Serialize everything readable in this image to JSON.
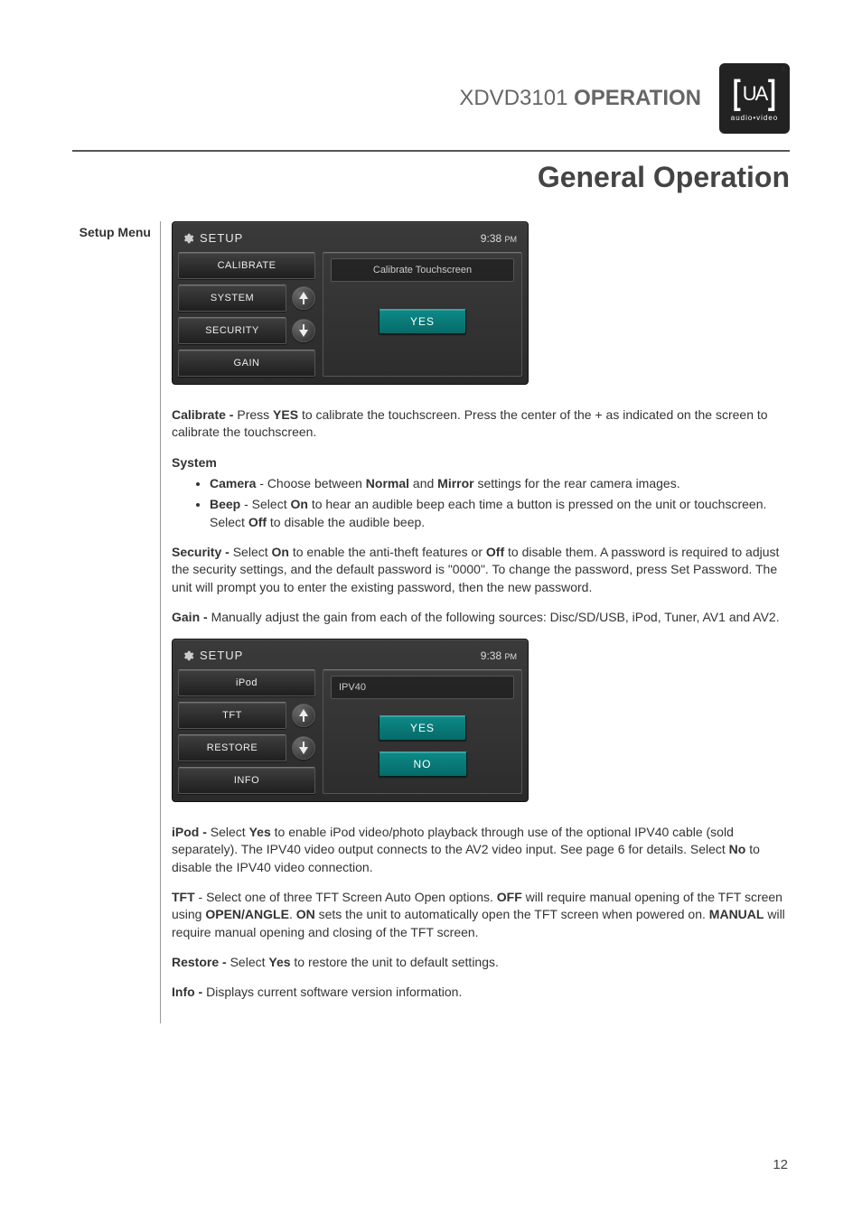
{
  "header": {
    "model": "XDVD3101",
    "section": "OPERATION",
    "logo_sub": "audio•video",
    "trademark": "®"
  },
  "page_heading": "General Operation",
  "left_label": "Setup Menu",
  "screen1": {
    "title": "SETUP",
    "time": "9:38",
    "time_suffix": "PM",
    "menu": {
      "item1": "CALIBRATE",
      "item2": "SYSTEM",
      "item3": "SECURITY",
      "item4": "GAIN"
    },
    "panel_title": "Calibrate Touchscreen",
    "yes": "YES"
  },
  "screen2": {
    "title": "SETUP",
    "time": "9:38",
    "time_suffix": "PM",
    "menu": {
      "item1": "iPod",
      "item2": "TFT",
      "item3": "RESTORE",
      "item4": "INFO"
    },
    "panel_title": "IPV40",
    "yes": "YES",
    "no": "NO"
  },
  "text": {
    "calibrate_label": "Calibrate - ",
    "calibrate_pre": "Press ",
    "calibrate_yes": "YES",
    "calibrate_body": " to calibrate the touchscreen. Press the center of the + as indicated on the screen to calibrate the touchscreen.",
    "system_heading": "System",
    "camera_label": "Camera",
    "camera_pre": " - Choose between ",
    "camera_normal": "Normal",
    "camera_and": " and ",
    "camera_mirror": "Mirror",
    "camera_post": " settings for the rear camera images.",
    "beep_label": "Beep",
    "beep_pre": " - Select ",
    "beep_on": "On",
    "beep_mid": " to hear an audible beep each time a button is pressed on the unit or touchscreen. Select ",
    "beep_off": "Off",
    "beep_post": " to disable the audible beep.",
    "security_label": "Security - ",
    "security_pre": "Select ",
    "security_on": "On",
    "security_mid1": " to enable the anti-theft features or ",
    "security_off": "Off",
    "security_body": " to disable them. A password is required to adjust the security settings, and the default password is \"0000\". To change the password, press Set Password. The unit will prompt you to enter the existing password, then the new password.",
    "gain_label": "Gain - ",
    "gain_body": "Manually adjust the gain from each of the following sources: Disc/SD/USB, iPod, Tuner, AV1 and AV2.",
    "ipod_label": "iPod - ",
    "ipod_pre": "Select ",
    "ipod_yes": "Yes",
    "ipod_mid": " to enable iPod video/photo playback through use of the optional IPV40 cable (sold separately). The IPV40 video output connects to the AV2 video input. See page 6 for details. Select ",
    "ipod_no": "No",
    "ipod_post": " to disable the IPV40 video connection.",
    "tft_label": "TFT",
    "tft_pre": " - Select one of three TFT Screen Auto Open options. ",
    "tft_off": "OFF",
    "tft_mid1": " will require manual opening of the TFT screen using ",
    "tft_openangle": "OPEN/ANGLE",
    "tft_mid2": ". ",
    "tft_on": "ON",
    "tft_mid3": " sets the unit to automatically open the TFT screen when powered on. ",
    "tft_manual": "MANUAL",
    "tft_post": " will require manual opening and closing of the TFT screen.",
    "restore_label": "Restore - ",
    "restore_pre": "Select ",
    "restore_yes": "Yes",
    "restore_body": " to restore the unit to default settings.",
    "info_label": "Info - ",
    "info_body": "Displays current software version information."
  },
  "page_number": "12"
}
